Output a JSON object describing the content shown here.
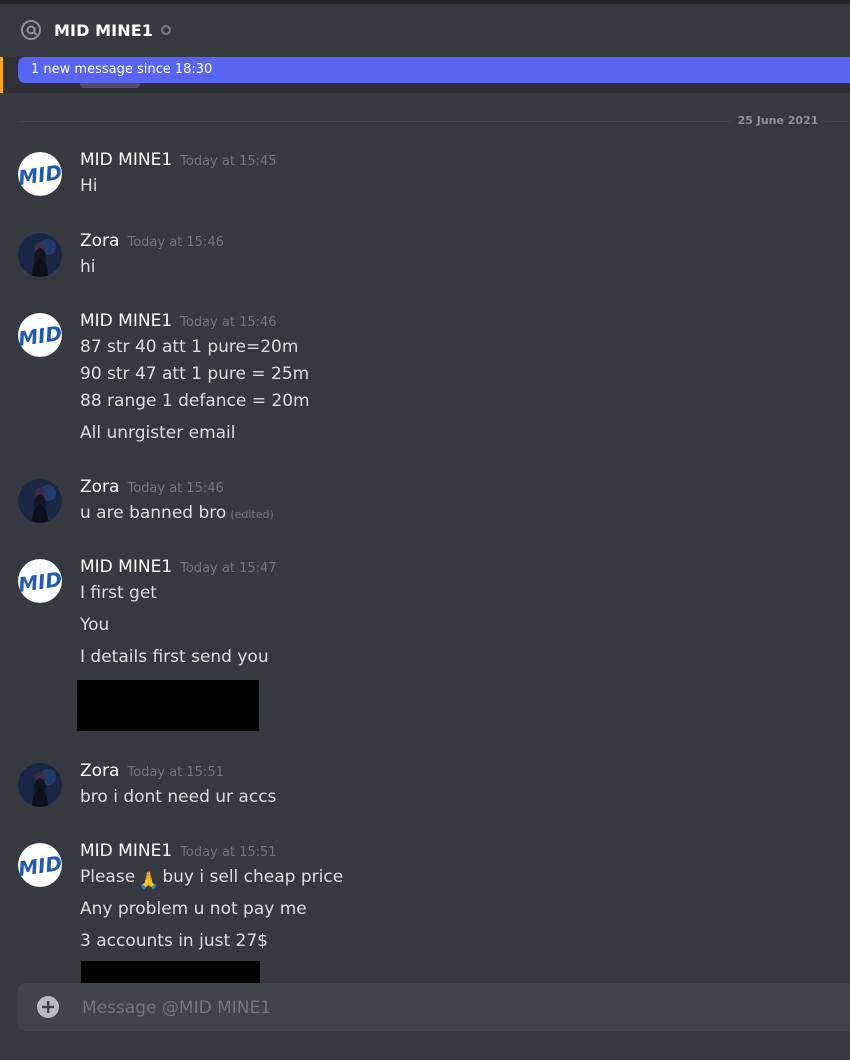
{
  "header": {
    "title": "MID MINE1",
    "icon": "at-sign-icon",
    "status": "offline"
  },
  "banner": {
    "text": "1 new message since 18:30"
  },
  "date_divider": "25 June 2021",
  "messages": [
    {
      "author": "MID MINE1",
      "time": "Today at 15:45",
      "lines": [
        "Hi"
      ]
    },
    {
      "author": "Zora",
      "time": "Today at 15:46",
      "lines": [
        "hi"
      ]
    },
    {
      "author": "MID MINE1",
      "time": "Today at 15:46",
      "lines": [
        "87 str 40 att 1 pure=20m",
        "90 str 47 att  1 pure = 25m",
        "88 range 1 defance = 20m",
        "All unrgister email"
      ]
    },
    {
      "author": "Zora",
      "time": "Today at 15:46",
      "lines": [
        "u are banned bro"
      ],
      "edited": "(edited)"
    },
    {
      "author": "MID MINE1",
      "time": "Today at 15:47",
      "lines": [
        "I first get",
        "You",
        "I details first send you"
      ]
    },
    {
      "author": "Zora",
      "time": "Today at 15:51",
      "lines": [
        "bro i dont need ur accs"
      ]
    },
    {
      "author": "MID MINE1",
      "time": "Today at 15:51",
      "lines": [
        "Please",
        "buy i sell cheap price",
        "Any problem u not pay me",
        "3 accounts in just 27$"
      ],
      "emoji": "🙏"
    }
  ],
  "composer": {
    "placeholder": "Message @MID MINE1"
  },
  "colors": {
    "background": "#36393f",
    "banner": "#5865f2",
    "accent": "#faa61a",
    "composer": "#40444b"
  }
}
